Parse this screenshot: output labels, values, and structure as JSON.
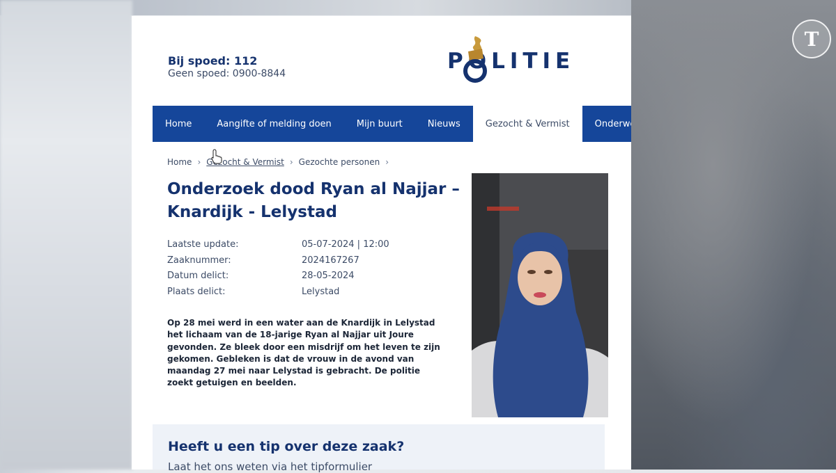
{
  "watermark": "T",
  "header": {
    "urgent": "Bij spoed: 112",
    "non_urgent": "Geen spoed: 0900-8844",
    "logo_text": "POLITIE"
  },
  "nav": {
    "items": [
      {
        "label": "Home"
      },
      {
        "label": "Aangifte of melding doen"
      },
      {
        "label": "Mijn buurt"
      },
      {
        "label": "Nieuws"
      },
      {
        "label": "Gezocht & Vermist",
        "active": true
      },
      {
        "label": "Onderwerpen"
      }
    ]
  },
  "breadcrumb": [
    "Home",
    "Gezocht & Vermist",
    "Gezochte personen"
  ],
  "case": {
    "title": "Onderzoek dood Ryan al Najjar – Knardijk - Lelystad",
    "details": [
      {
        "label": "Laatste update:",
        "value": "05-07-2024 | 12:00"
      },
      {
        "label": "Zaaknummer:",
        "value": "2024167267"
      },
      {
        "label": "Datum delict:",
        "value": "28-05-2024"
      },
      {
        "label": "Plaats delict:",
        "value": "Lelystad"
      }
    ],
    "description": "Op 28 mei werd in een water aan de Knardijk in Lelystad het lichaam van de 18-jarige Ryan al Najjar uit Joure gevonden. Ze bleek door een misdrijf om het leven te zijn gekomen. Gebleken is dat de vrouw in de avond van maandag 27 mei naar Lelystad is gebracht. De politie zoekt getuigen en beelden."
  },
  "tip": {
    "title": "Heeft u een tip over deze zaak?",
    "subtitle": "Laat het ons weten via het tipformulier"
  },
  "colors": {
    "brand_blue": "#15326e",
    "nav_blue": "#15469a",
    "gold": "#c89a3c"
  }
}
